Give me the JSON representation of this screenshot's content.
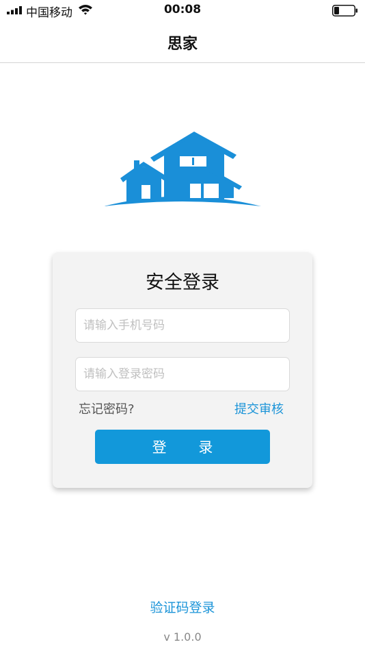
{
  "status_bar": {
    "carrier": "中国移动",
    "time": "00:08",
    "battery_level": 0.25
  },
  "nav": {
    "title": "思家"
  },
  "logo": {
    "icon": "house-icon",
    "color": "#1a8fd8"
  },
  "login_card": {
    "title": "安全登录",
    "phone_placeholder": "请输入手机号码",
    "password_placeholder": "请输入登录密码",
    "forgot_password": "忘记密码?",
    "submit_review": "提交审核",
    "login_button": "登 录"
  },
  "footer": {
    "code_login": "验证码登录",
    "version": "v 1.0.0"
  },
  "colors": {
    "accent": "#1298da",
    "link": "#1b94d8",
    "card_bg": "#f3f3f3"
  }
}
